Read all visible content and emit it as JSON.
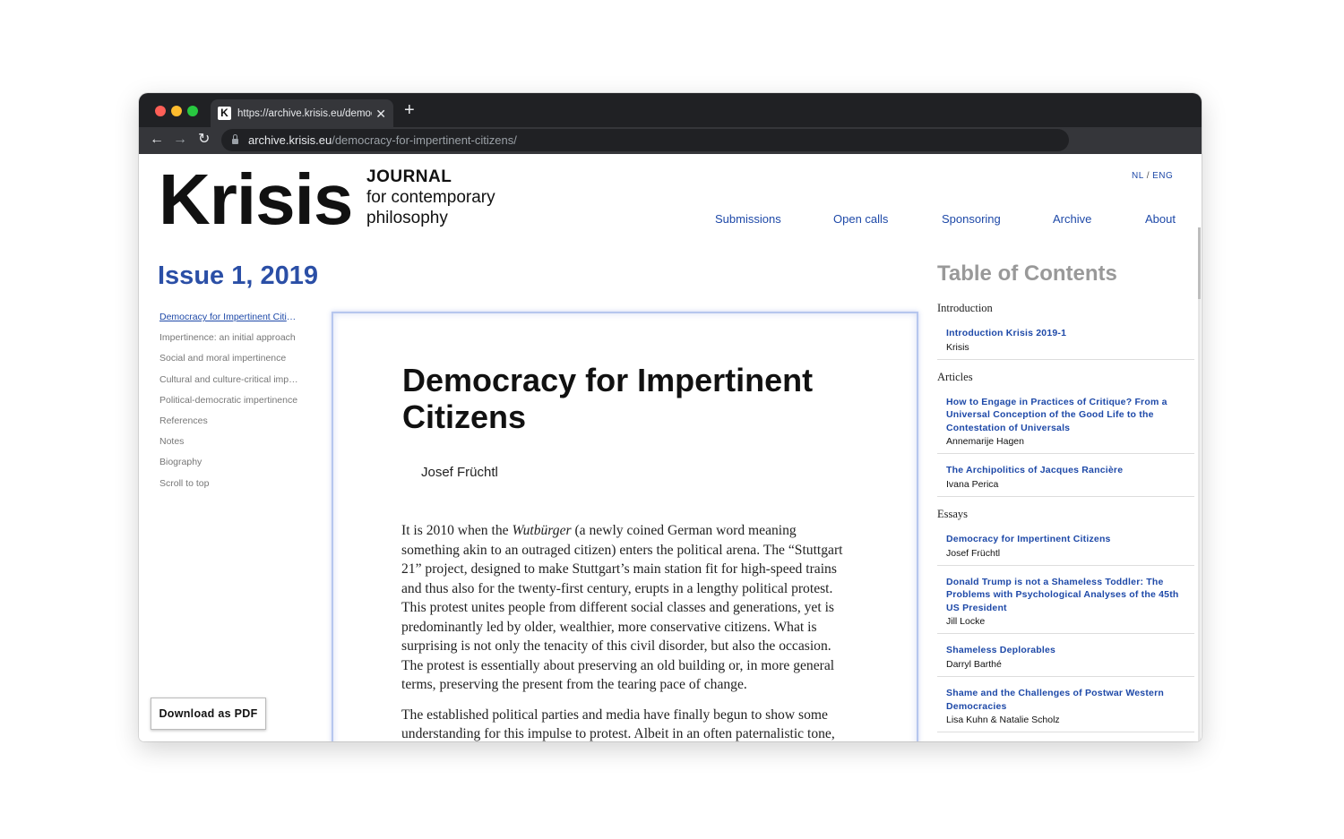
{
  "browser": {
    "tab_title": "https://archive.krisis.eu/democ",
    "favicon": "K",
    "url_host": "archive.krisis.eu",
    "url_path": "/democracy-for-impertinent-citizens/",
    "icons": {
      "back": "←",
      "forward": "→",
      "reload": "↻",
      "close": "✕",
      "new_tab": "+"
    }
  },
  "header": {
    "logo_word": "Krisis",
    "logo_line1": "JOURNAL",
    "logo_line2": "for contemporary",
    "logo_line3": "philosophy",
    "lang_nl": "NL",
    "lang_sep": "/",
    "lang_eng": "ENG"
  },
  "nav": [
    "Submissions",
    "Open calls",
    "Sponsoring",
    "Archive",
    "About"
  ],
  "issue_title": "Issue 1, 2019",
  "left_nav": [
    "Democracy for Impertinent Citizens",
    "Impertinence: an initial approach",
    "Social and moral impertinence",
    "Cultural and culture-critical impertinence",
    "Political-democratic impertinence",
    "References",
    "Notes",
    "Biography",
    "Scroll to top"
  ],
  "download_label": "Download as PDF",
  "article": {
    "title": "Democracy for Impertinent Citizens",
    "author": "Josef Früchtl",
    "p1_a": "It is 2010 when the ",
    "p1_em": "Wutbürger",
    "p1_b": " (a newly coined German word meaning something akin to an outraged citizen) enters the political arena. The “Stuttgart 21” project, designed to make Stuttgart’s main station fit for high-speed trains and thus also for the twenty-first century, erupts in a lengthy political protest. This protest unites people from different social classes and generations, yet is predominantly led by older, wealthier, more conservative citizens. What is surprising is not only the tenacity of this civil disorder, but also the occasion. The protest is essentially about preserving an old building or, in more general terms, preserving the present from the tearing pace of change.",
    "p2": "The established political parties and media have finally begun to show some understanding for this impulse to protest. Albeit in an often paternalistic tone,"
  },
  "toc": {
    "title": "Table of Contents",
    "sections": [
      {
        "name": "Introduction",
        "entries": [
          {
            "title": "Introduction Krisis 2019-1",
            "author": "Krisis"
          }
        ]
      },
      {
        "name": "Articles",
        "entries": [
          {
            "title": "How to Engage in Practices of Critique? From a Universal Conception of the Good Life to the Contestation of Universals",
            "author": "Annemarije Hagen"
          },
          {
            "title": "The Archipolitics of Jacques Rancière",
            "author": "Ivana Perica"
          }
        ]
      },
      {
        "name": "Essays",
        "entries": [
          {
            "title": "Democracy for Impertinent Citizens",
            "author": "Josef Früchtl"
          },
          {
            "title": "Donald Trump is not a Shameless Toddler: The Problems with Psychological Analyses of the 45th US President",
            "author": "Jill Locke"
          },
          {
            "title": "Shameless Deplorables",
            "author": "Darryl Barthé"
          },
          {
            "title": "Shame and the Challenges of Postwar Western Democracies",
            "author": "Lisa Kuhn & Natalie Scholz"
          }
        ]
      }
    ]
  }
}
